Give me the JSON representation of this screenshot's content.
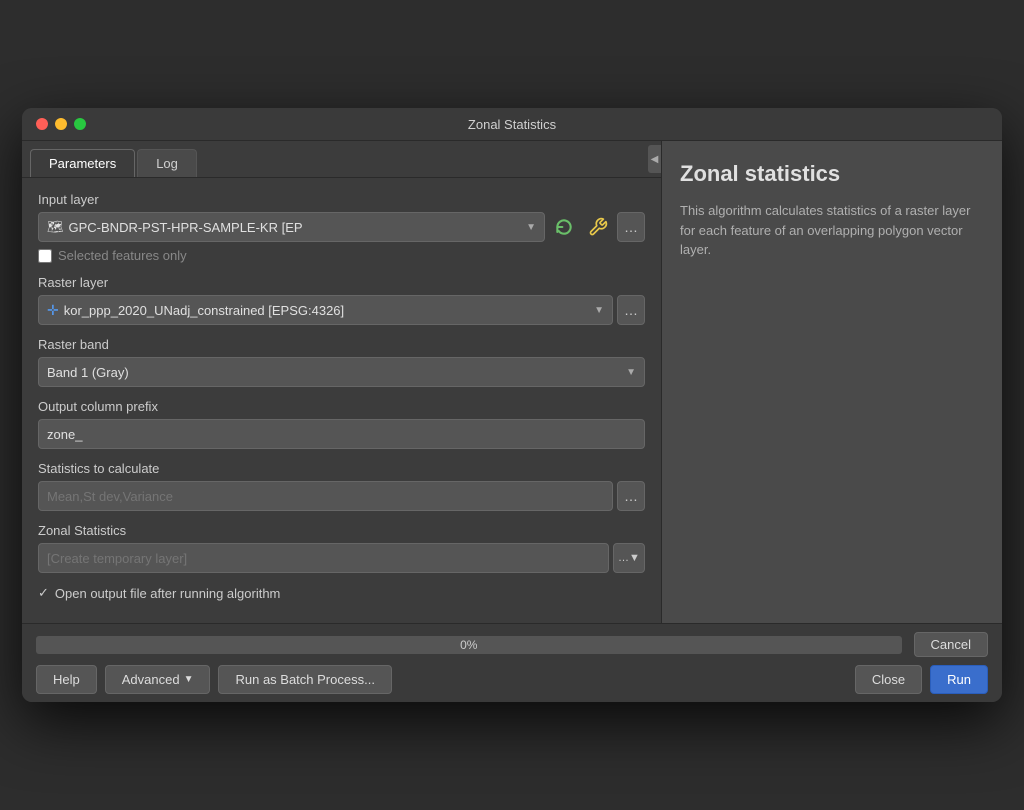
{
  "window": {
    "title": "Zonal Statistics"
  },
  "tabs": {
    "parameters": "Parameters",
    "log": "Log",
    "active": "parameters"
  },
  "input_layer": {
    "label": "Input layer",
    "value": "GPC-BNDR-PST-HPR-SAMPLE-KR [EP",
    "selected_features_only": "Selected features only",
    "selected": false
  },
  "raster_layer": {
    "label": "Raster layer",
    "value": "kor_ppp_2020_UNadj_constrained [EPSG:4326]"
  },
  "raster_band": {
    "label": "Raster band",
    "value": "Band 1 (Gray)"
  },
  "output_column_prefix": {
    "label": "Output column prefix",
    "value": "zone_"
  },
  "statistics": {
    "label": "Statistics to calculate",
    "placeholder": "Mean,St dev,Variance"
  },
  "zonal_statistics_output": {
    "label": "Zonal Statistics",
    "placeholder": "[Create temporary layer]"
  },
  "open_output": {
    "text": "Open output file after running algorithm",
    "checked": true
  },
  "progress": {
    "value": "0%",
    "percent": 0
  },
  "buttons": {
    "help": "Help",
    "advanced": "Advanced",
    "run_batch": "Run as Batch Process...",
    "close": "Close",
    "run": "Run",
    "cancel": "Cancel"
  },
  "help": {
    "title": "Zonal statistics",
    "description": "This algorithm calculates statistics of a raster layer for each feature of an overlapping polygon vector layer."
  }
}
